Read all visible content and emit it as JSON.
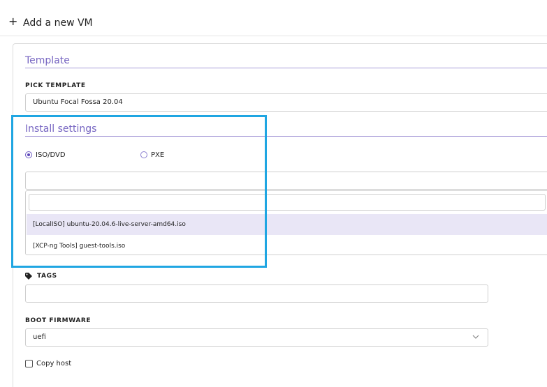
{
  "header": {
    "plus_symbol": "+",
    "title": "Add a new VM"
  },
  "template_section": {
    "title": "Template",
    "pick_template_label": "PICK TEMPLATE",
    "pick_template_value": "Ubuntu Focal Fossa 20.04"
  },
  "install_section": {
    "title": "Install settings",
    "options": [
      {
        "label": "ISO/DVD",
        "selected": true
      },
      {
        "label": "PXE",
        "selected": false
      }
    ],
    "iso_value": "",
    "dropdown": {
      "search_value": "",
      "options": [
        {
          "label": "[LocalISO] ubuntu-20.04.6-live-server-amd64.iso",
          "highlighted": true
        },
        {
          "label": "[XCP-ng Tools] guest-tools.iso",
          "highlighted": false
        }
      ]
    }
  },
  "tags": {
    "icon": "tag-icon",
    "label": "TAGS",
    "value": ""
  },
  "boot_firmware": {
    "label": "BOOT FIRMWARE",
    "value": "uefi",
    "icon": "chevron-down-icon"
  },
  "copy_host": {
    "label": "Copy host",
    "checked": false
  },
  "colors": {
    "accent": "#7766c2",
    "highlight_box": "#1fa6e2",
    "option_highlight": "#e9e6f6"
  }
}
